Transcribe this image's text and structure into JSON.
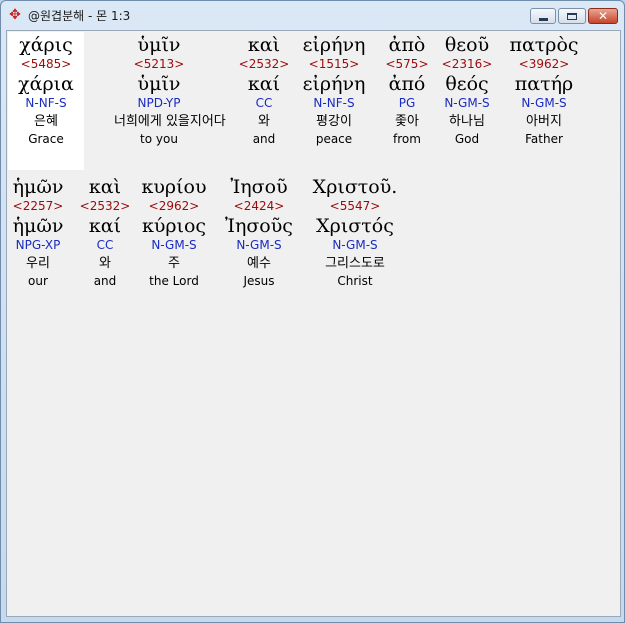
{
  "window": {
    "title": "@원겹분해 - 몬 1:3",
    "app_icon": "interlinear-app-icon",
    "controls": {
      "minimize": "minimize-icon",
      "maximize": "maximize-icon",
      "close": "close-icon",
      "close_glyph": "✕"
    }
  },
  "interlinear": {
    "line1": [
      {
        "greek": "χάρις",
        "strong": "<5485>",
        "lemma": "χάρια",
        "parse": "N-NF-S",
        "korean": "은혜",
        "english": "Grace"
      },
      {
        "greek": "ὑμῖν",
        "strong": "<5213>",
        "lemma": "ὑμῖν",
        "parse": "NPD-YP",
        "korean": "너희에게 있을지어다",
        "english": "to you"
      },
      {
        "greek": "καὶ",
        "strong": "<2532>",
        "lemma": "καί",
        "parse": "CC",
        "korean": "와",
        "english": "and"
      },
      {
        "greek": "εἰρήνη",
        "strong": "<1515>",
        "lemma": "εἰρήνη",
        "parse": "N-NF-S",
        "korean": "평강이",
        "english": "peace"
      },
      {
        "greek": "ἀπὸ",
        "strong": "<575>",
        "lemma": "ἀπό",
        "parse": "PG",
        "korean": "좇아",
        "english": "from"
      },
      {
        "greek": "θεοῦ",
        "strong": "<2316>",
        "lemma": "θεός",
        "parse": "N-GM-S",
        "korean": "하나님",
        "english": "God"
      },
      {
        "greek": "πατρὸς",
        "strong": "<3962>",
        "lemma": "πατήρ",
        "parse": "N-GM-S",
        "korean": "아버지",
        "english": "Father"
      }
    ],
    "line2": [
      {
        "greek": "ἡμῶν",
        "strong": "<2257>",
        "lemma": "ἡμῶν",
        "parse": "NPG-XP",
        "korean": "우리",
        "english": "our"
      },
      {
        "greek": "καὶ",
        "strong": "<2532>",
        "lemma": "καί",
        "parse": "CC",
        "korean": "와",
        "english": "and"
      },
      {
        "greek": "κυρίου",
        "strong": "<2962>",
        "lemma": "κύριος",
        "parse": "N-GM-S",
        "korean": "주",
        "english": "the Lord"
      },
      {
        "greek": "Ἰησοῦ",
        "strong": "<2424>",
        "lemma": "Ἰησοῦς",
        "parse": "N-GM-S",
        "korean": "예수",
        "english": "Jesus"
      },
      {
        "greek": "Χριστοῦ.",
        "strong": "<5547>",
        "lemma": "Χριστός",
        "parse": "N-GM-S",
        "korean": "그리스도로",
        "english": "Christ"
      }
    ]
  },
  "colors": {
    "strong_number": "#9a0a0a",
    "parsing_code": "#1a2bc0",
    "selected_word_background": "#ffffff",
    "client_background": "#f0f0f0"
  }
}
